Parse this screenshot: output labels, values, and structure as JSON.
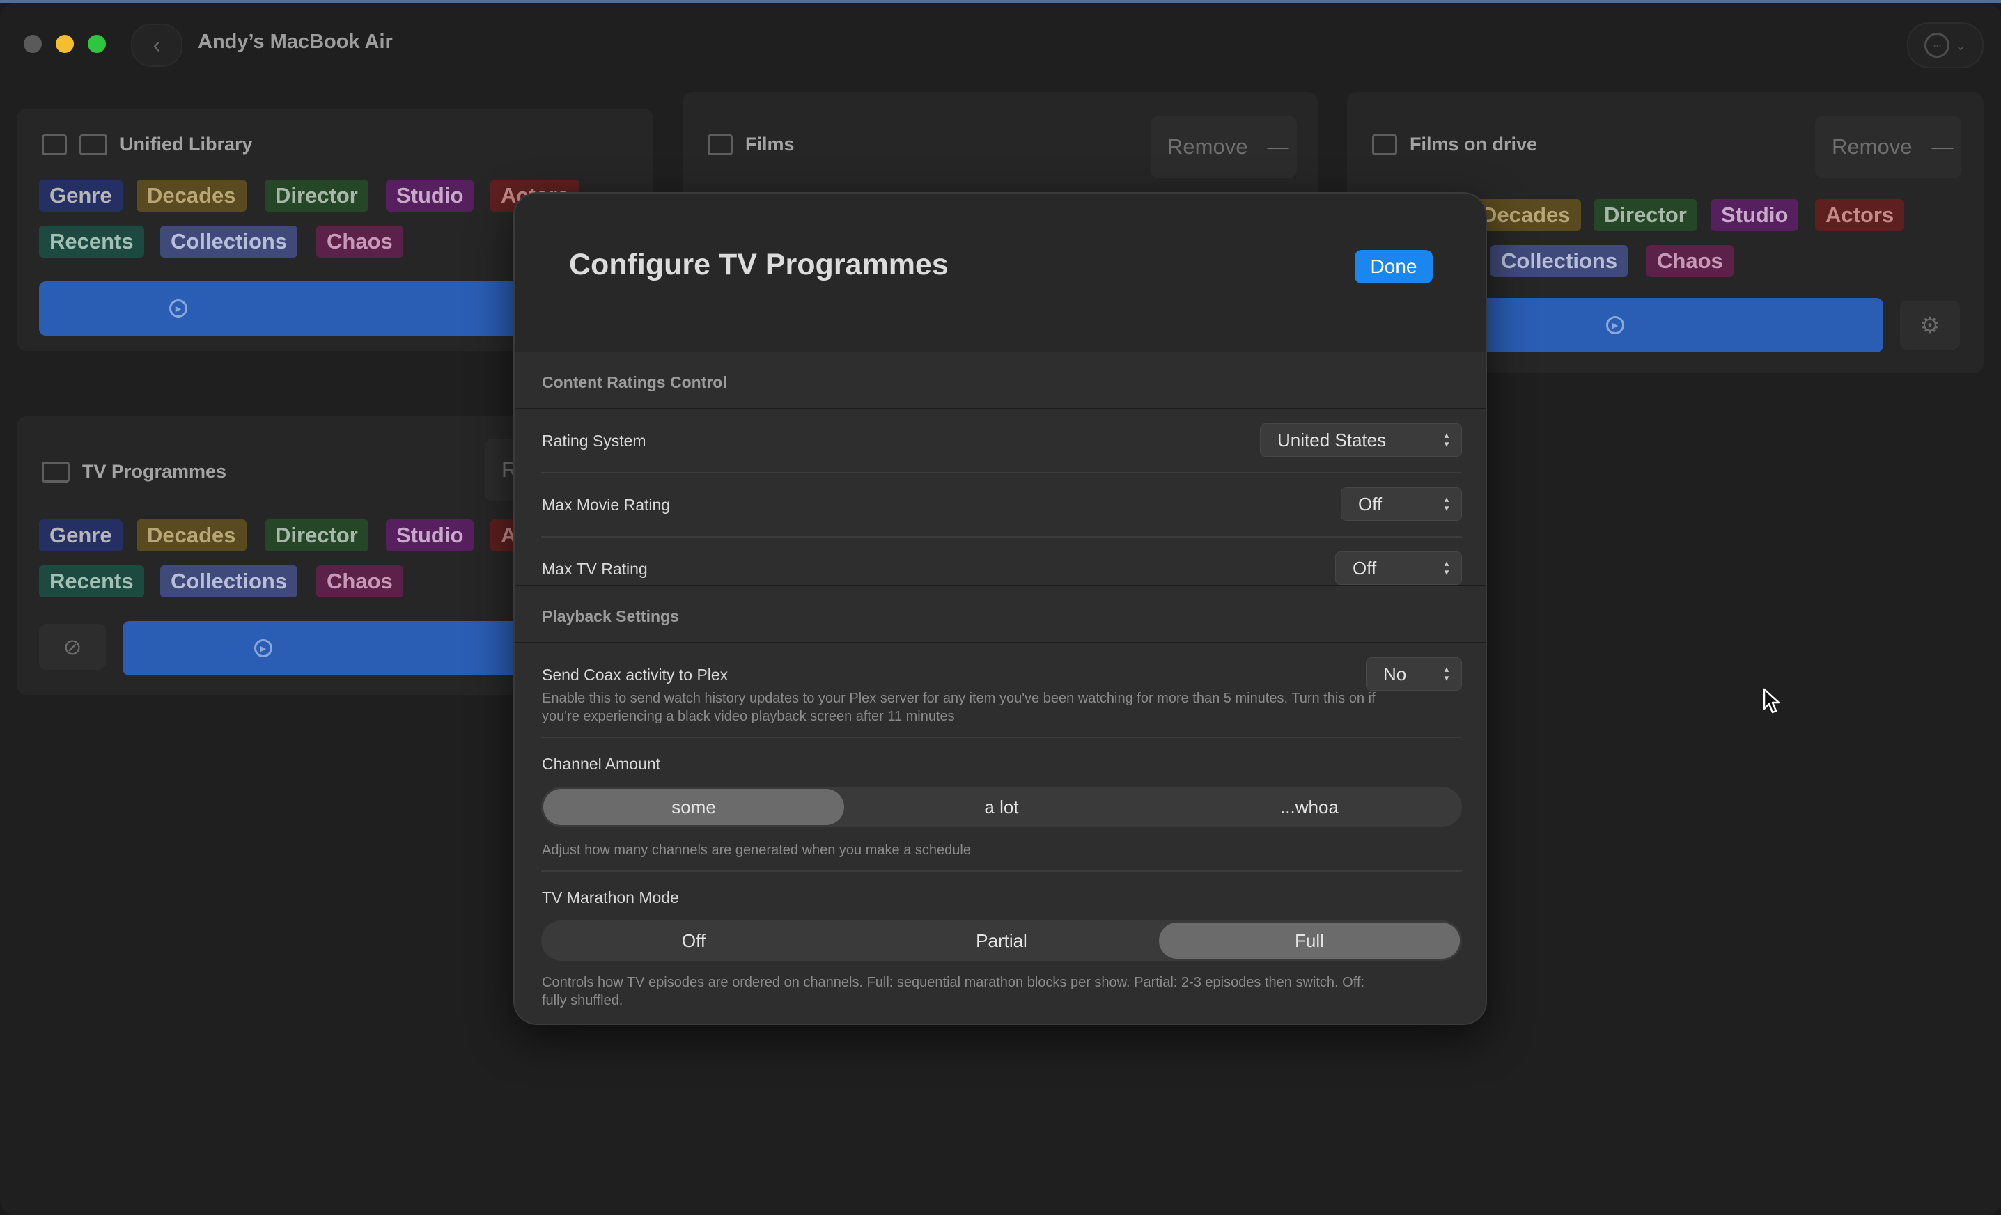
{
  "window": {
    "title": "Andy’s MacBook Air"
  },
  "cards": {
    "unified": {
      "title": "Unified Library",
      "tags": [
        "Genre",
        "Decades",
        "Director",
        "Studio",
        "Actors",
        "Recents",
        "Collections",
        "Chaos"
      ]
    },
    "films": {
      "title": "Films",
      "remove_label": "Remove"
    },
    "films_drive": {
      "title": "Films on drive",
      "remove_label": "Remove",
      "tags": [
        "Decades",
        "Director",
        "Studio",
        "Actors",
        "Collections",
        "Chaos"
      ]
    },
    "tv": {
      "title": "TV Programmes",
      "remove_partial": "R",
      "tags": [
        "Genre",
        "Decades",
        "Director",
        "Studio",
        "A",
        "Recents",
        "Collections",
        "Chaos"
      ]
    }
  },
  "modal": {
    "title": "Configure TV Programmes",
    "done_label": "Done",
    "content_section": {
      "header": "Content Ratings Control",
      "rows": [
        {
          "label": "Rating System",
          "value": "United States"
        },
        {
          "label": "Max Movie Rating",
          "value": "Off"
        },
        {
          "label": "Max TV Rating",
          "value": "Off"
        }
      ]
    },
    "playback_section": {
      "header": "Playback Settings",
      "coax": {
        "label": "Send Coax activity to Plex",
        "value": "No",
        "help_line1": "Enable this to send watch history updates to your Plex server for any item you've been watching for more than 5 minutes. Turn this on if",
        "help_line2": "you're experiencing a black video playback screen after 11 minutes"
      },
      "channel_amount": {
        "label": "Channel Amount",
        "options": [
          "some",
          "a lot",
          "...whoa"
        ],
        "selected": "some",
        "help": "Adjust how many channels are generated when you make a schedule"
      },
      "marathon": {
        "label": "TV Marathon Mode",
        "options": [
          "Off",
          "Partial",
          "Full"
        ],
        "selected": "Full",
        "help_line1": "Controls how TV episodes are ordered on channels. Full: sequential marathon blocks per show. Partial: 2-3 episodes then switch. Off:",
        "help_line2": "fully shuffled."
      }
    }
  }
}
